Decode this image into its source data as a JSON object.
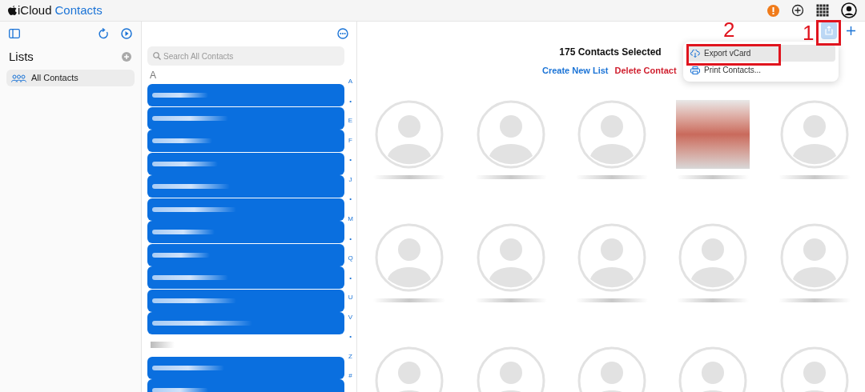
{
  "app_title": {
    "brand": "iCloud",
    "product": "Contacts"
  },
  "sidebar": {
    "title": "Lists",
    "items": [
      {
        "label": "All Contacts",
        "selected": true
      }
    ]
  },
  "search": {
    "placeholder": "Search All Contacts"
  },
  "contact_list": {
    "section": "A",
    "rows": [
      {
        "selected": true
      },
      {
        "selected": true
      },
      {
        "selected": true
      },
      {
        "selected": true
      },
      {
        "selected": true
      },
      {
        "selected": true
      },
      {
        "selected": true
      },
      {
        "selected": true
      },
      {
        "selected": true
      },
      {
        "selected": true
      },
      {
        "selected": true
      },
      {
        "kind": "blurred_header"
      },
      {
        "selected": true
      },
      {
        "selected": true
      }
    ]
  },
  "index": [
    "A",
    "•",
    "E",
    "F",
    "•",
    "J",
    "•",
    "M",
    "•",
    "Q",
    "•",
    "U",
    "V",
    "•",
    "Z",
    "#"
  ],
  "selection": {
    "summary": "175 Contacts Selected",
    "actions": [
      {
        "label": "Create New List",
        "kind": "normal"
      },
      {
        "label": "Delete Contact",
        "kind": "destructive"
      }
    ]
  },
  "menu": {
    "items": [
      {
        "label": "Export vCard",
        "kind": "cloud",
        "selected": true
      },
      {
        "label": "Print Contacts...",
        "kind": "printer",
        "selected": false
      }
    ]
  },
  "annotations": [
    {
      "label": "2"
    },
    {
      "label": "1"
    }
  ],
  "cards": [
    {
      "kind": "silhouette"
    },
    {
      "kind": "silhouette"
    },
    {
      "kind": "silhouette"
    },
    {
      "kind": "photo"
    },
    {
      "kind": "silhouette"
    },
    {
      "kind": "silhouette"
    },
    {
      "kind": "silhouette"
    },
    {
      "kind": "silhouette"
    },
    {
      "kind": "silhouette"
    },
    {
      "kind": "silhouette"
    },
    {
      "kind": "silhouette"
    },
    {
      "kind": "silhouette"
    },
    {
      "kind": "silhouette"
    },
    {
      "kind": "silhouette"
    },
    {
      "kind": "silhouette"
    }
  ]
}
